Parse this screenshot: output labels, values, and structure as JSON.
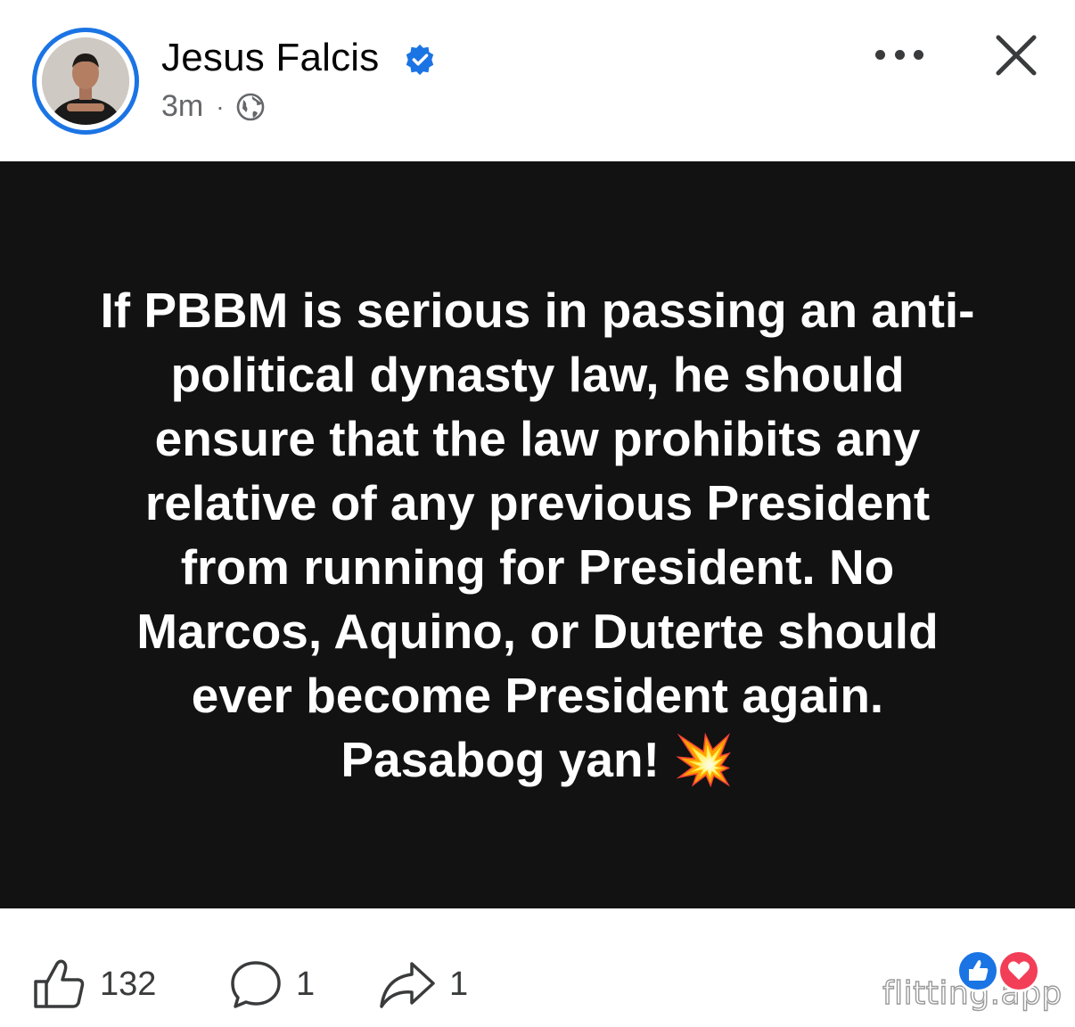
{
  "post": {
    "author": "Jesus Falcis",
    "verified": true,
    "timestamp": "3m",
    "separator": "·",
    "audience_icon": "globe-icon",
    "text": "If PBBM is serious in passing an anti-political dynasty law, he should ensure that the law prohibits any relative of any previous President from running for President. No Marcos, Aquino, or Duterte should ever become President again. Pasabog yan! 💥",
    "background_color": "#121212",
    "text_color": "#ffffff"
  },
  "header_actions": {
    "more_icon": "more-horizontal-icon",
    "close_icon": "close-icon"
  },
  "footer": {
    "likes": "132",
    "comments": "1",
    "shares": "1",
    "reactions": [
      "like",
      "love"
    ]
  },
  "watermark": "flitting.app",
  "colors": {
    "accent": "#1b74e4",
    "love": "#f33e58",
    "secondary_text": "#65676b"
  }
}
